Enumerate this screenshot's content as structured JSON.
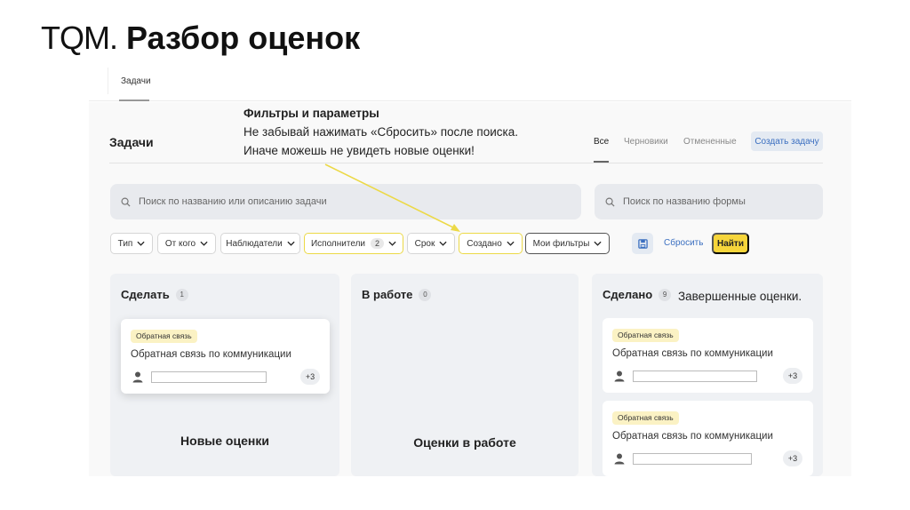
{
  "slide": {
    "title_prefix": "TQM.",
    "title_main": "Разбор оценок"
  },
  "topnav": {
    "tab_label": "Задачи"
  },
  "header": {
    "title": "Задачи",
    "tabs": [
      "Все",
      "Черновики",
      "Отмененные"
    ],
    "active_tab": "Все",
    "create_button": "Создать задачу"
  },
  "annotation": {
    "title": "Фильтры и параметры",
    "line1": "Не забывай нажимать «Сбросить» после поиска.",
    "line2": "Иначе можешь не увидеть новые оценки!"
  },
  "search": {
    "tasks_placeholder": "Поиск по названию или описанию задачи",
    "forms_placeholder": "Поиск по названию формы"
  },
  "filters": {
    "type": "Тип",
    "from": "От кого",
    "observers": "Наблюдатели",
    "executors": "Исполнители",
    "executors_count": "2",
    "deadline": "Срок",
    "created": "Создано",
    "my_filters": "Мои фильтры",
    "reset": "Сбросить",
    "find": "Найти"
  },
  "columns": {
    "todo": {
      "title": "Сделать",
      "count": "1",
      "note": "Новые оценки",
      "cards": [
        {
          "badge": "Обратная связь",
          "title": "Обратная связь по коммуникации",
          "extra": "+3"
        }
      ]
    },
    "work": {
      "title": "В работе",
      "count": "0",
      "note": "Оценки в работе"
    },
    "done": {
      "title": "Сделано",
      "count": "9",
      "note": "Завершенные оценки.",
      "cards": [
        {
          "badge": "Обратная связь",
          "title": "Обратная связь по коммуникации",
          "extra": "+3"
        },
        {
          "badge": "Обратная связь",
          "title": "Обратная связь по коммуникации",
          "extra": "+3"
        }
      ]
    }
  },
  "colors": {
    "accent_yellow": "#f6d53b",
    "highlight_border": "#ecd947",
    "link_blue": "#3b6fc0",
    "badge_bg": "#fbf2c4",
    "column_bg": "#eff1f4"
  }
}
